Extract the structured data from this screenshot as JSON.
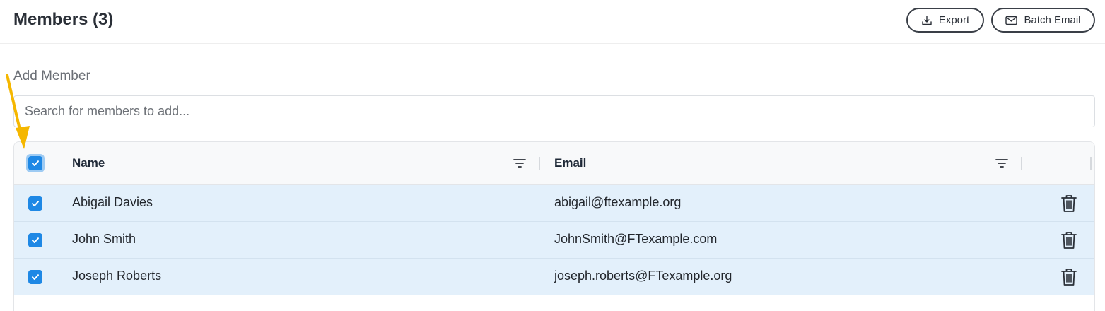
{
  "header": {
    "title": "Members (3)",
    "export_label": "Export",
    "batch_email_label": "Batch Email"
  },
  "add_member": {
    "label": "Add Member",
    "search_placeholder": "Search for members to add...",
    "search_value": ""
  },
  "table": {
    "columns": {
      "name": "Name",
      "email": "Email"
    },
    "select_all_checked": true,
    "rows": [
      {
        "name": "Abigail Davies",
        "email": "abigail@ftexample.org",
        "selected": true
      },
      {
        "name": "John Smith",
        "email": "JohnSmith@FTexample.com",
        "selected": true
      },
      {
        "name": "Joseph Roberts",
        "email": "joseph.roberts@FTexample.org",
        "selected": true
      }
    ]
  },
  "colors": {
    "accent": "#1e88e5",
    "selected_row": "#e3f0fb",
    "annotation_arrow": "#f5b700"
  },
  "icons": [
    "download-icon",
    "mail-icon",
    "filter-icon",
    "trash-icon",
    "check-icon",
    "annotation-arrow"
  ]
}
